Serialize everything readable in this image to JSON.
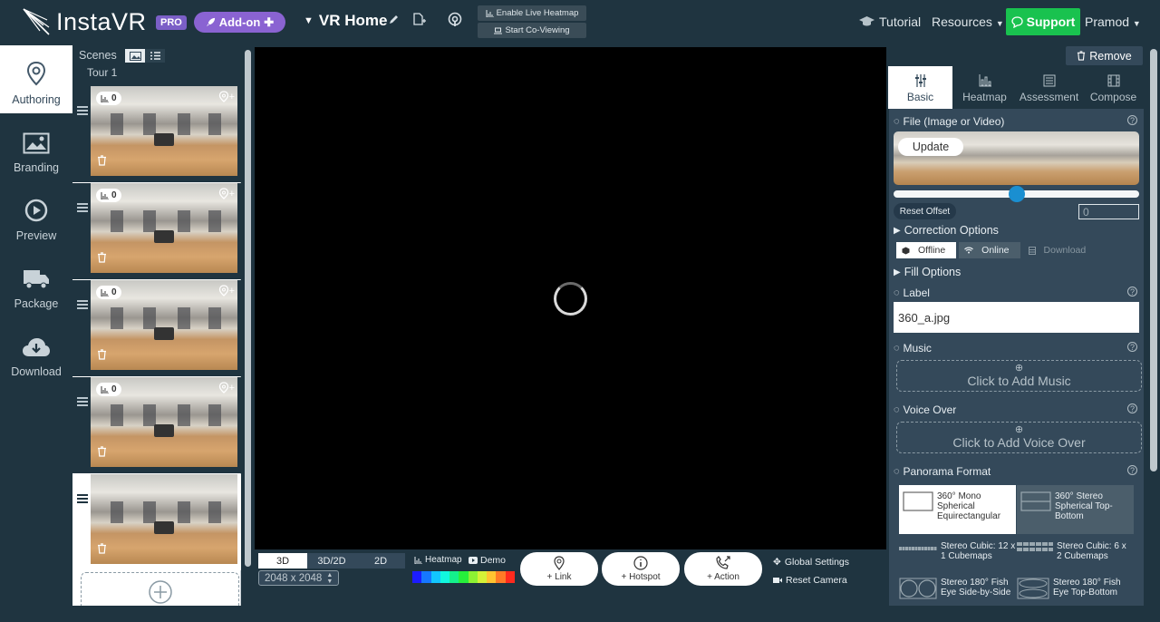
{
  "header": {
    "logo_text": "InstaVR",
    "pro_badge": "PRO",
    "addon_label": "Add-on",
    "project_title": "VR Home",
    "live_heatmap_label": "Enable Live Heatmap",
    "coviewing_label": "Start Co-Viewing",
    "tutorial_label": "Tutorial",
    "resources_label": "Resources",
    "support_label": "Support",
    "user_name": "Pramod"
  },
  "leftnav": {
    "items": [
      {
        "label": "Authoring",
        "icon": "map-pin-icon"
      },
      {
        "label": "Branding",
        "icon": "image-icon"
      },
      {
        "label": "Preview",
        "icon": "play-icon"
      },
      {
        "label": "Package",
        "icon": "truck-icon"
      },
      {
        "label": "Download",
        "icon": "cloud-download-icon"
      }
    ]
  },
  "scenes": {
    "title": "Scenes",
    "tour_label": "Tour 1",
    "items": [
      {
        "count": "0"
      },
      {
        "count": "0"
      },
      {
        "count": "0"
      },
      {
        "count": "0"
      },
      {
        "count": ""
      }
    ]
  },
  "toolbar": {
    "dim_tabs": [
      "3D",
      "3D/2D",
      "2D"
    ],
    "resolution": "2048 x 2048",
    "heatmap_label": "Heatmap",
    "demo_label": "Demo",
    "link_label": "+ Link",
    "hotspot_label": "+ Hotspot",
    "action_label": "+ Action",
    "global_settings_label": "Global Settings",
    "reset_camera_label": "Reset Camera",
    "heat_colors": [
      "#1c1cff",
      "#1677ff",
      "#12c6ff",
      "#11f7df",
      "#14f08c",
      "#27f03b",
      "#8df233",
      "#d5f237",
      "#ffc431",
      "#ff7a26",
      "#ff2a1e"
    ]
  },
  "rightpanel": {
    "remove_label": "Remove",
    "tabs": [
      "Basic",
      "Heatmap",
      "Assessment",
      "Compose"
    ],
    "file_label": "File (Image or Video)",
    "update_label": "Update",
    "slider_level": 0.5,
    "reset_offset_label": "Reset Offset",
    "offset_value": "0",
    "correction_label": "Correction Options",
    "offline_label": "Offline",
    "online_label": "Online",
    "download_label": "Download",
    "fill_label": "Fill Options",
    "label_label": "Label",
    "label_value": "360_a.jpg",
    "music_label": "Music",
    "add_music_label": "Click to Add Music",
    "voiceover_label": "Voice Over",
    "add_voiceover_label": "Click to Add Voice Over",
    "panorama_label": "Panorama Format",
    "formats": [
      "360° Mono Spherical Equirectangular",
      "360° Stereo Spherical Top-Bottom",
      "Stereo Cubic: 12 x 1 Cubemaps",
      "Stereo Cubic: 6 x 2 Cubemaps",
      "Stereo 180° Fish Eye Side-by-Side",
      "Stereo 180° Fish Eye Top-Bottom"
    ]
  }
}
